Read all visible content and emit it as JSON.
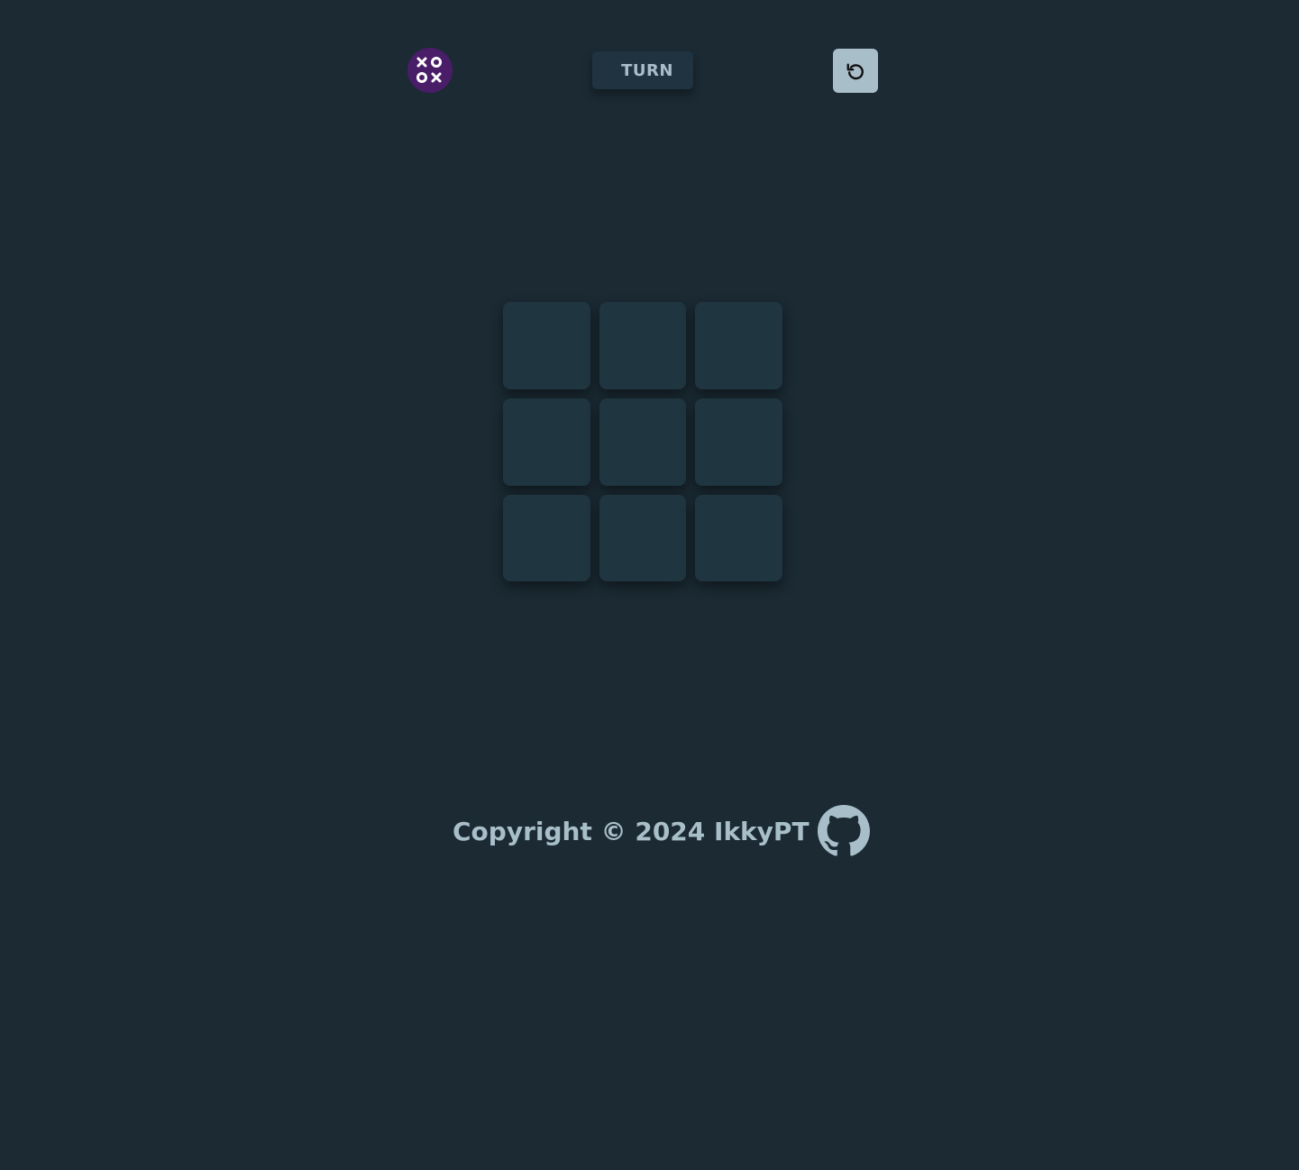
{
  "header": {
    "logo_icon": "xo-logo-icon",
    "logo_text_top": "XO",
    "logo_text_bottom": "OX",
    "turn_label": "TURN",
    "reset_icon": "reset-icon"
  },
  "board": {
    "cells": [
      "",
      "",
      "",
      "",
      "",
      "",
      "",
      "",
      ""
    ]
  },
  "footer": {
    "copyright": "Copyright © 2024 IkkyPT",
    "github_icon": "github-icon"
  },
  "colors": {
    "background": "#1b2a33",
    "cell": "#1f3540",
    "accent": "#a8bec9",
    "logo": "#4a1d68"
  }
}
